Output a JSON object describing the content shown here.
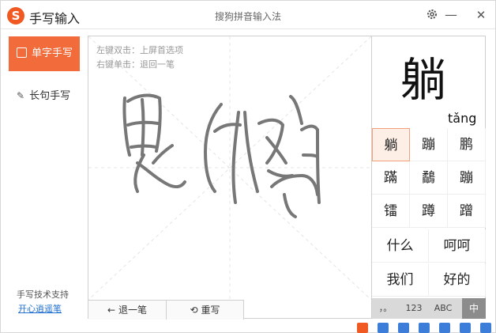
{
  "titlebar": {
    "logo_letter": "S",
    "app_title": "手写输入",
    "caption": "搜狗拼音输入法",
    "settings_icon": "gear-icon",
    "minimize_glyph": "—",
    "close_glyph": "✕"
  },
  "sidebar": {
    "single_char_label": "单字手写",
    "sentence_label": "长句手写",
    "tech_support": "手写技术支持",
    "tech_link": "开心逍遥笔"
  },
  "pad": {
    "hint_left_double": "左键双击：上屏首选项",
    "hint_right_single": "右键单击：退回一笔",
    "undo_label": "退一笔",
    "undo_glyph": "←",
    "rewrite_label": "重写",
    "rewrite_glyph": "⟲"
  },
  "candidates": {
    "preview_char": "躺",
    "preview_pinyin": "tǎng",
    "chars": [
      "躺",
      "蹦",
      "鹏",
      "蹣",
      "鷸",
      "蹦",
      "镭",
      "蹲",
      "蹭"
    ],
    "words": [
      "什么",
      "呵呵",
      "我们",
      "好的"
    ]
  },
  "input_bar": {
    "punct": "，。",
    "digits": "123",
    "letters": "ABC",
    "chinese": "中"
  },
  "colors": {
    "accent": "#f26b3a",
    "ink": "#777777",
    "link": "#1f6fd1"
  }
}
